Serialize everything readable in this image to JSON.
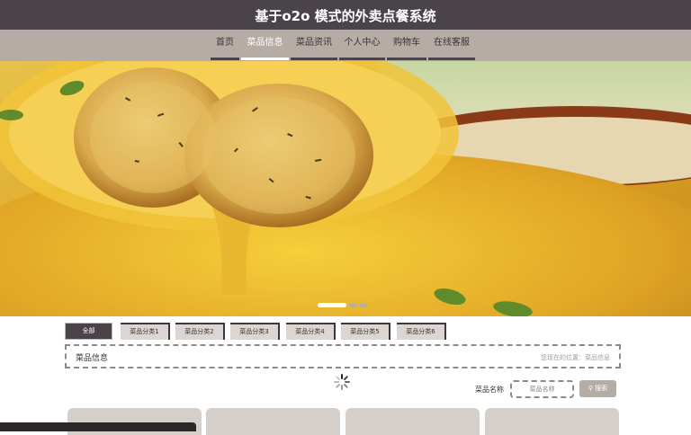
{
  "header": {
    "title": "基于o2o 模式的外卖点餐系统"
  },
  "nav": {
    "items": [
      {
        "label": "首页",
        "active": false
      },
      {
        "label": "菜品信息",
        "active": true
      },
      {
        "label": "菜品资讯",
        "active": false
      },
      {
        "label": "个人中心",
        "active": false
      },
      {
        "label": "购物车",
        "active": false
      },
      {
        "label": "在线客服",
        "active": false
      }
    ]
  },
  "carousel": {
    "slide_count": 3,
    "active_index": 0
  },
  "categories": [
    {
      "label": "全部",
      "active": true
    },
    {
      "label": "菜品分类1",
      "active": false
    },
    {
      "label": "菜品分类2",
      "active": false
    },
    {
      "label": "菜品分类3",
      "active": false
    },
    {
      "label": "菜品分类4",
      "active": false
    },
    {
      "label": "菜品分类5",
      "active": false
    },
    {
      "label": "菜品分类6",
      "active": false
    }
  ],
  "section": {
    "title": "菜品信息",
    "breadcrumb": "您现在的位置：菜品信息"
  },
  "search": {
    "label": "菜品名称",
    "placeholder": "菜品名称",
    "button_label": "搜索",
    "button_icon": "search-icon"
  },
  "colors": {
    "header_bg": "#4a434a",
    "nav_bg": "#b5aca6",
    "accent": "#4a434a",
    "card_bg": "#d4cfca"
  }
}
